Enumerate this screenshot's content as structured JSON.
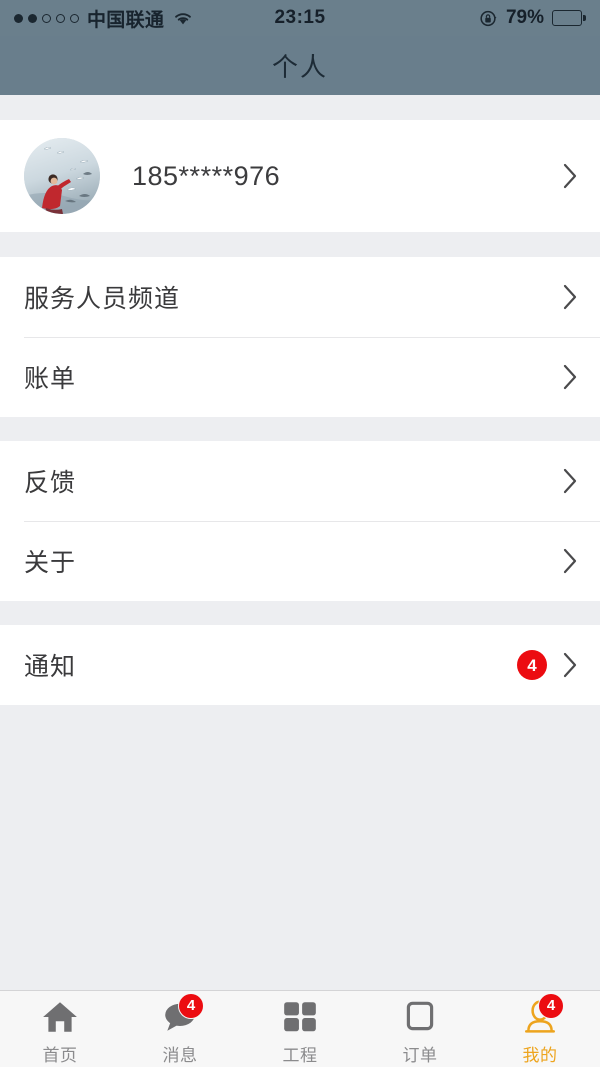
{
  "status_bar": {
    "signal_dots_filled": 2,
    "signal_dots_total": 5,
    "carrier": "中国联通",
    "wifi_icon": "wifi-icon",
    "time": "23:15",
    "rotation_lock_icon": "rotation-lock-icon",
    "battery_percent": "79%",
    "battery_level": 79
  },
  "nav": {
    "title": "个人"
  },
  "profile": {
    "avatar_icon": "user-avatar",
    "phone": "185*****976",
    "chevron_icon": "chevron-right-icon"
  },
  "groups": [
    {
      "rows": [
        {
          "label": "服务人员频道",
          "badge": null,
          "chevron_icon": "chevron-right-icon"
        },
        {
          "label": "账单",
          "badge": null,
          "chevron_icon": "chevron-right-icon"
        }
      ]
    },
    {
      "rows": [
        {
          "label": "反馈",
          "badge": null,
          "chevron_icon": "chevron-right-icon"
        },
        {
          "label": "关于",
          "badge": null,
          "chevron_icon": "chevron-right-icon"
        }
      ]
    },
    {
      "rows": [
        {
          "label": "通知",
          "badge": "4",
          "chevron_icon": "chevron-right-icon"
        }
      ]
    }
  ],
  "tabbar": {
    "items": [
      {
        "label": "首页",
        "icon": "home-icon",
        "badge": null,
        "active": false
      },
      {
        "label": "消息",
        "icon": "chat-bubble-icon",
        "badge": "4",
        "active": false
      },
      {
        "label": "工程",
        "icon": "grid-icon",
        "badge": null,
        "active": false
      },
      {
        "label": "订单",
        "icon": "square-outline-icon",
        "badge": null,
        "active": false
      },
      {
        "label": "我的",
        "icon": "person-icon",
        "badge": "4",
        "active": true
      }
    ]
  },
  "colors": {
    "navbar": "#697e8c",
    "statusbar": "#6a7f8c",
    "page_background": "#edeef1",
    "row_background": "#ffffff",
    "badge_red": "#ec0c11",
    "active_tab": "#eda41e",
    "inactive_tab": "#8b8b8d"
  }
}
